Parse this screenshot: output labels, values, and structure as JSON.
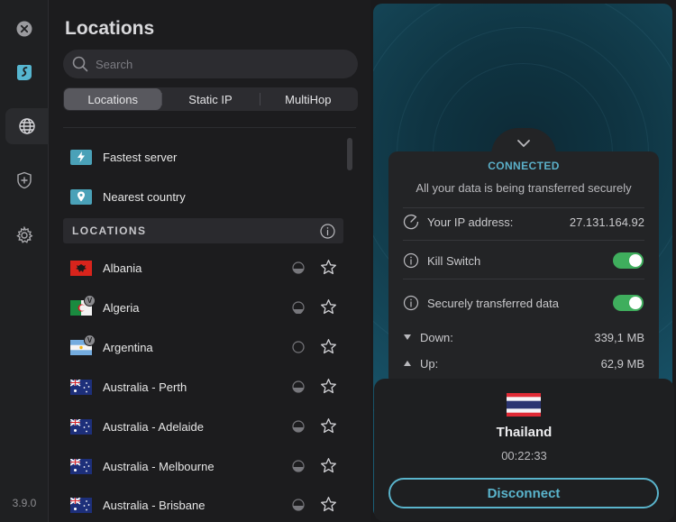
{
  "app": {
    "version": "3.9.0",
    "accent": "#5ab4cc"
  },
  "sidebar": {
    "items": [
      {
        "name": "close",
        "icon": "close-icon"
      },
      {
        "name": "logo",
        "icon": "surfshark-logo-icon"
      },
      {
        "name": "locations",
        "icon": "globe-icon",
        "active": true
      },
      {
        "name": "protection",
        "icon": "shield-plus-icon"
      },
      {
        "name": "settings",
        "icon": "gear-icon"
      }
    ]
  },
  "panel": {
    "title": "Locations",
    "search_placeholder": "Search",
    "tabs": [
      {
        "label": "Locations",
        "active": true
      },
      {
        "label": "Static IP",
        "active": false
      },
      {
        "label": "MultiHop",
        "active": false
      }
    ],
    "quick": [
      {
        "label": "Fastest server",
        "icon": "bolt-icon"
      },
      {
        "label": "Nearest country",
        "icon": "pin-icon"
      }
    ],
    "section_title": "LOCATIONS",
    "locations": [
      {
        "label": "Albania",
        "flag": "albania",
        "virtual": false
      },
      {
        "label": "Algeria",
        "flag": "algeria",
        "virtual": true
      },
      {
        "label": "Argentina",
        "flag": "argentina",
        "virtual": true
      },
      {
        "label": "Australia - Perth",
        "flag": "australia",
        "virtual": false
      },
      {
        "label": "Australia - Adelaide",
        "flag": "australia",
        "virtual": false
      },
      {
        "label": "Australia - Melbourne",
        "flag": "australia",
        "virtual": false
      },
      {
        "label": "Australia - Brisbane",
        "flag": "australia",
        "virtual": false
      }
    ],
    "virtual_badge": "V"
  },
  "status": {
    "state": "CONNECTED",
    "message": "All your data is being transferred securely",
    "ip_label": "Your IP address:",
    "ip_value": "27.131.164.92",
    "kill_switch_label": "Kill Switch",
    "kill_switch_on": true,
    "secure_label": "Securely transferred data",
    "secure_on": true,
    "down_label": "Down:",
    "down_value": "339,1 MB",
    "up_label": "Up:",
    "up_value": "62,9 MB"
  },
  "connection": {
    "country": "Thailand",
    "elapsed": "00:22:33",
    "button": "Disconnect"
  }
}
